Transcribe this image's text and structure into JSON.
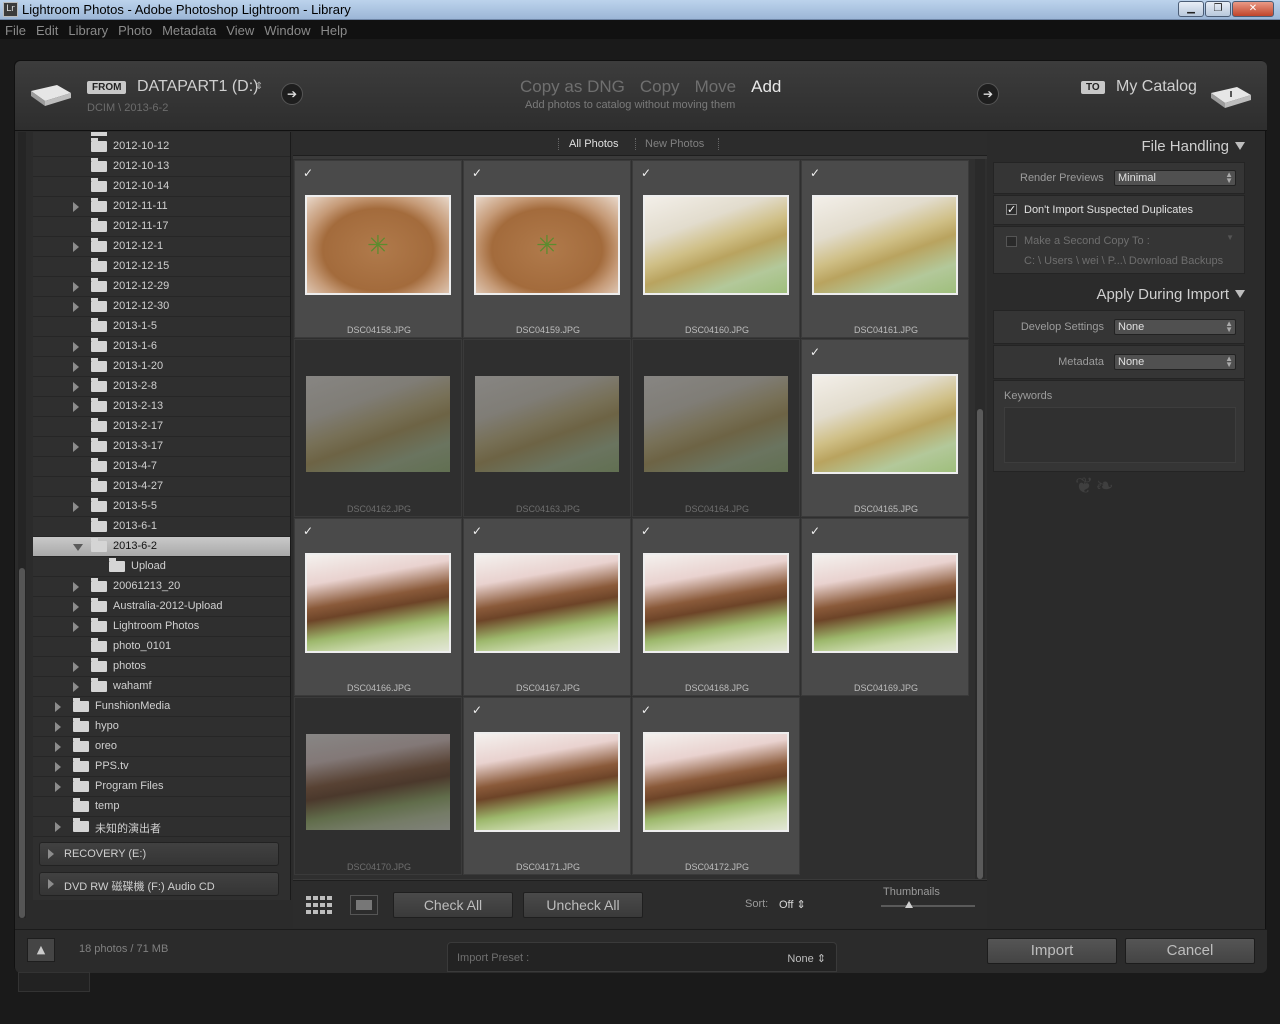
{
  "window": {
    "title": "Lightroom Photos - Adobe Photoshop Lightroom - Library",
    "app_icon": "Lr"
  },
  "menu": [
    "File",
    "Edit",
    "Library",
    "Photo",
    "Metadata",
    "View",
    "Window",
    "Help"
  ],
  "source": {
    "from_badge": "FROM",
    "name": "DATAPART1 (D:)",
    "spinner": "⇕",
    "path": "DCIM \\ 2013-6-2"
  },
  "modes": {
    "items": [
      "Copy as DNG",
      "Copy",
      "Move",
      "Add"
    ],
    "active": "Add",
    "description": "Add photos to catalog without moving them"
  },
  "destination": {
    "to_badge": "TO",
    "name": "My Catalog"
  },
  "folders": [
    {
      "label": "2012-10-12",
      "expandable": false
    },
    {
      "label": "2012-10-13",
      "expandable": false
    },
    {
      "label": "2012-10-14",
      "expandable": false
    },
    {
      "label": "2012-11-11",
      "expandable": true
    },
    {
      "label": "2012-11-17",
      "expandable": false
    },
    {
      "label": "2012-12-1",
      "expandable": true
    },
    {
      "label": "2012-12-15",
      "expandable": false
    },
    {
      "label": "2012-12-29",
      "expandable": true
    },
    {
      "label": "2012-12-30",
      "expandable": true
    },
    {
      "label": "2013-1-5",
      "expandable": false
    },
    {
      "label": "2013-1-6",
      "expandable": true
    },
    {
      "label": "2013-1-20",
      "expandable": true
    },
    {
      "label": "2013-2-8",
      "expandable": true
    },
    {
      "label": "2013-2-13",
      "expandable": true
    },
    {
      "label": "2013-2-17",
      "expandable": false
    },
    {
      "label": "2013-3-17",
      "expandable": true
    },
    {
      "label": "2013-4-7",
      "expandable": false
    },
    {
      "label": "2013-4-27",
      "expandable": false
    },
    {
      "label": "2013-5-5",
      "expandable": true
    },
    {
      "label": "2013-6-1",
      "expandable": false
    },
    {
      "label": "2013-6-2",
      "expandable": true,
      "selected": true
    },
    {
      "label": "Upload",
      "expandable": false
    },
    {
      "label": "20061213_20",
      "expandable": true
    },
    {
      "label": "Australia-2012-Upload",
      "expandable": true
    },
    {
      "label": "Lightroom Photos",
      "expandable": true
    },
    {
      "label": "photo_0101",
      "expandable": false
    },
    {
      "label": "photos",
      "expandable": true
    },
    {
      "label": "wahamf",
      "expandable": true
    },
    {
      "label": "FunshionMedia",
      "expandable": true
    },
    {
      "label": "hypo",
      "expandable": true
    },
    {
      "label": "oreo",
      "expandable": true
    },
    {
      "label": "PPS.tv",
      "expandable": true
    },
    {
      "label": "Program Files",
      "expandable": true
    },
    {
      "label": "temp",
      "expandable": false
    },
    {
      "label": "未知的演出者",
      "expandable": true
    }
  ],
  "volumes": [
    "RECOVERY (E:)",
    "DVD RW 磁碟機 (F:) Audio CD"
  ],
  "filter_tabs": [
    "All Photos",
    "New Photos"
  ],
  "photos": [
    {
      "name": "DSC04158.JPG",
      "checked": true,
      "kind": "cake"
    },
    {
      "name": "DSC04159.JPG",
      "checked": true,
      "kind": "cake"
    },
    {
      "name": "DSC04160.JPG",
      "checked": true,
      "kind": "pie"
    },
    {
      "name": "DSC04161.JPG",
      "checked": true,
      "kind": "pie"
    },
    {
      "name": "DSC04162.JPG",
      "checked": false,
      "kind": "pie"
    },
    {
      "name": "DSC04163.JPG",
      "checked": false,
      "kind": "pie"
    },
    {
      "name": "DSC04164.JPG",
      "checked": false,
      "kind": "pie"
    },
    {
      "name": "DSC04165.JPG",
      "checked": true,
      "kind": "pie"
    },
    {
      "name": "DSC04166.JPG",
      "checked": true,
      "kind": "tira"
    },
    {
      "name": "DSC04167.JPG",
      "checked": true,
      "kind": "tira"
    },
    {
      "name": "DSC04168.JPG",
      "checked": true,
      "kind": "tira"
    },
    {
      "name": "DSC04169.JPG",
      "checked": true,
      "kind": "tira"
    },
    {
      "name": "DSC04170.JPG",
      "checked": false,
      "kind": "tira"
    },
    {
      "name": "DSC04171.JPG",
      "checked": true,
      "kind": "tira"
    },
    {
      "name": "DSC04172.JPG",
      "checked": true,
      "kind": "tira"
    }
  ],
  "toolbar": {
    "check_all": "Check All",
    "uncheck_all": "Uncheck All",
    "sort_label": "Sort:",
    "sort_value": "Off ⇕",
    "thumbnails_label": "Thumbnails"
  },
  "file_handling": {
    "header": "File Handling",
    "render_previews_label": "Render Previews",
    "render_previews_value": "Minimal",
    "dont_import_duplicates": "Don't Import Suspected Duplicates",
    "second_copy_label": "Make a Second Copy To :",
    "second_copy_path": "C: \\ Users \\ wei \\ P...\\ Download Backups"
  },
  "apply_during_import": {
    "header": "Apply During Import",
    "develop_settings_label": "Develop Settings",
    "develop_settings_value": "None",
    "metadata_label": "Metadata",
    "metadata_value": "None",
    "keywords_label": "Keywords"
  },
  "footer": {
    "photo_count": "18 photos / 71 MB",
    "import_preset_label": "Import Preset :",
    "import_preset_value": "None ⇕",
    "import_button": "Import",
    "cancel_button": "Cancel"
  }
}
